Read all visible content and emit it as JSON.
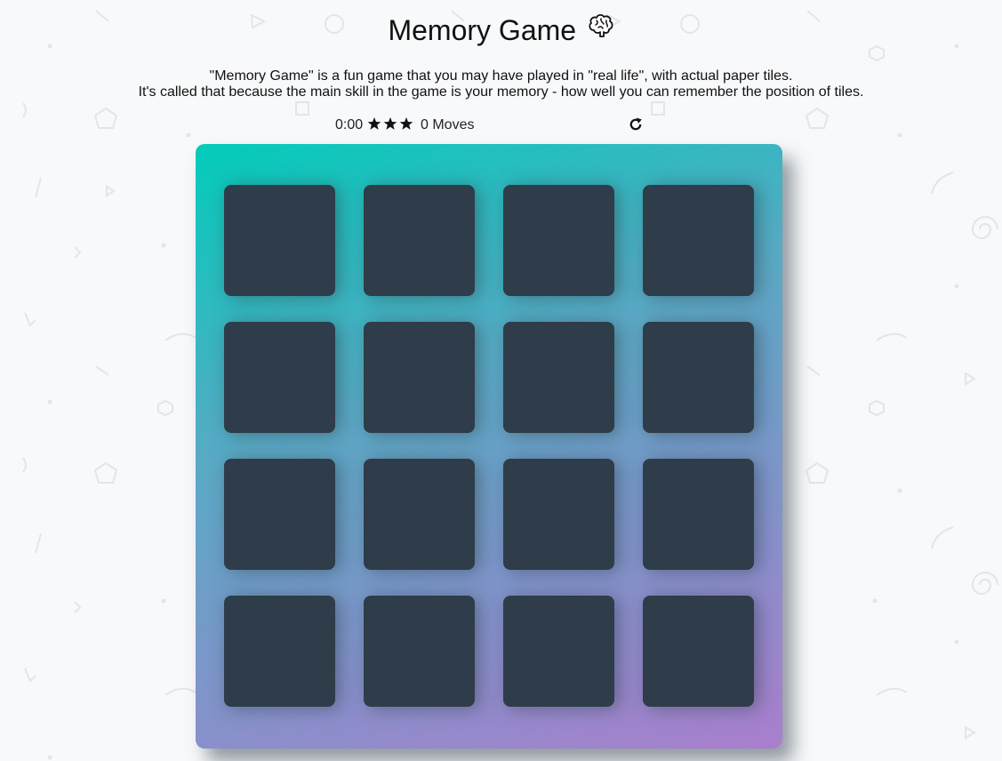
{
  "header": {
    "title": "Memory Game",
    "title_icon": "brain-icon"
  },
  "description": {
    "line1": "\"Memory Game\" is a fun game that you may have played in \"real life\", with actual paper tiles.",
    "line2": "It's called that because the main skill in the game is your memory - how well you can remember the position of tiles."
  },
  "score_panel": {
    "timer": "0:00",
    "stars": 3,
    "moves_label": "0 Moves",
    "restart_icon": "restart-icon"
  },
  "deck": {
    "rows": 4,
    "columns": 4,
    "cards": [
      {
        "state": "face-down"
      },
      {
        "state": "face-down"
      },
      {
        "state": "face-down"
      },
      {
        "state": "face-down"
      },
      {
        "state": "face-down"
      },
      {
        "state": "face-down"
      },
      {
        "state": "face-down"
      },
      {
        "state": "face-down"
      },
      {
        "state": "face-down"
      },
      {
        "state": "face-down"
      },
      {
        "state": "face-down"
      },
      {
        "state": "face-down"
      },
      {
        "state": "face-down"
      },
      {
        "state": "face-down"
      },
      {
        "state": "face-down"
      },
      {
        "state": "face-down"
      }
    ]
  },
  "colors": {
    "background": "#f8f9fb",
    "card_back": "#2e3d49",
    "deck_gradient_start": "#02ccba",
    "deck_gradient_end": "#aa7ecd"
  }
}
